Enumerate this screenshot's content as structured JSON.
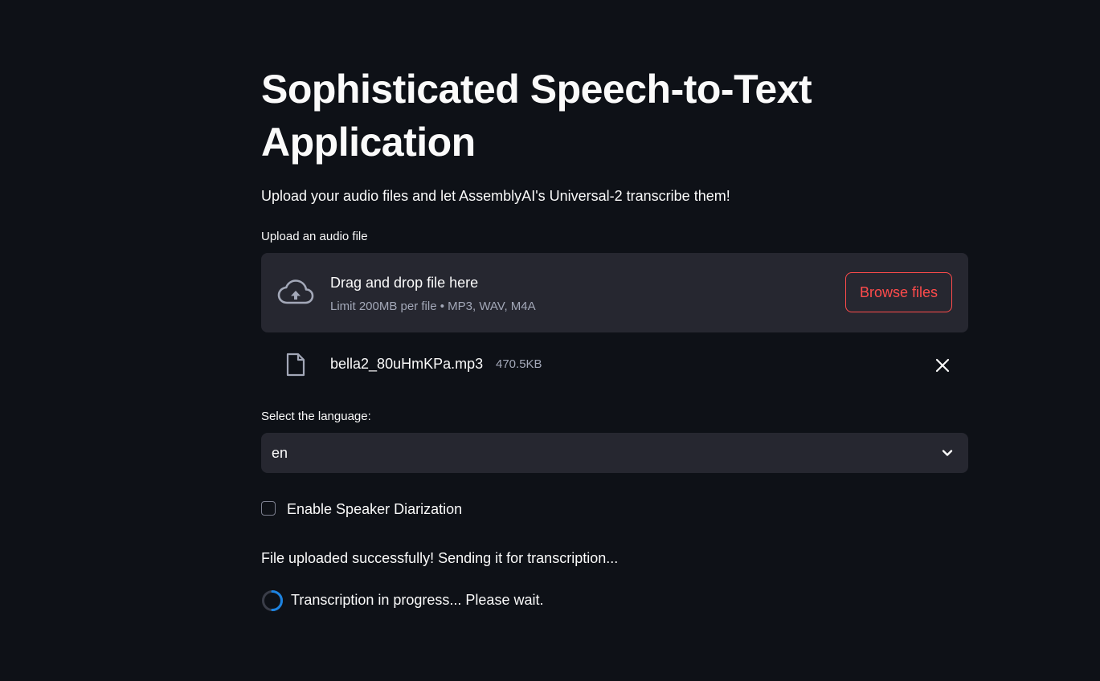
{
  "page": {
    "title": "Sophisticated Speech-to-Text Application",
    "subtitle": "Upload your audio files and let AssemblyAI's Universal-2 transcribe them!"
  },
  "uploader": {
    "label": "Upload an audio file",
    "drop_title": "Drag and drop file here",
    "limit_text": "Limit 200MB per file • MP3, WAV, M4A",
    "browse_label": "Browse files",
    "icon": "cloud-upload-icon"
  },
  "uploaded_file": {
    "name": "bella2_80uHmKPa.mp3",
    "size": "470.5KB",
    "icon": "file-icon",
    "remove_icon": "close-icon"
  },
  "language_select": {
    "label": "Select the language:",
    "value": "en",
    "icon": "chevron-down-icon"
  },
  "diarization": {
    "label": "Enable Speaker Diarization",
    "checked": false
  },
  "status": {
    "message": "File uploaded successfully! Sending it for transcription...",
    "progress_message": "Transcription in progress... Please wait."
  },
  "colors": {
    "background": "#0e1117",
    "surface": "#262730",
    "accent": "#ff4b4b",
    "muted_text": "#a3a8b8",
    "spinner": "#1c83e1"
  }
}
